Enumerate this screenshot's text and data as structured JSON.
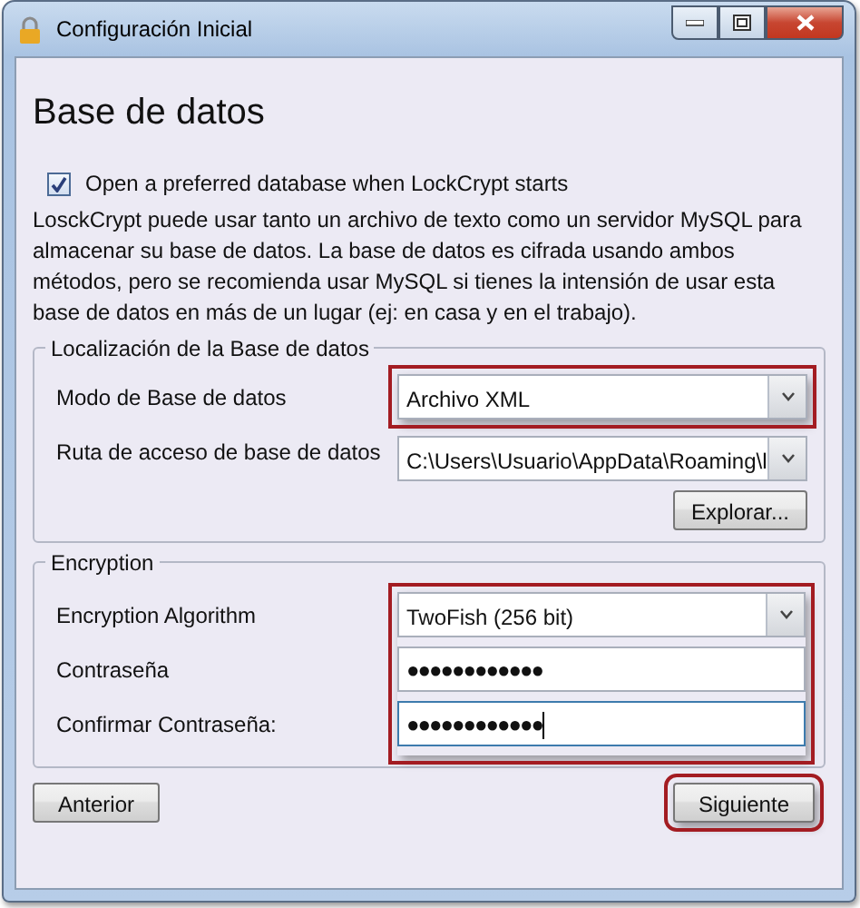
{
  "window": {
    "title": "Configuración Inicial"
  },
  "heading": "Base de datos",
  "open_preferred": {
    "label": "Open a preferred database when LockCrypt starts",
    "checked": true
  },
  "description": "LosckCrypt puede usar tanto un archivo de texto como un servidor MySQL para almacenar su base de datos. La base de datos es cifrada usando ambos métodos, pero se recomienda usar MySQL si tienes la intensión de usar esta base de datos en más de un lugar (ej: en casa y en el trabajo).",
  "sections": [
    {
      "title": "Localización de la Base de datos",
      "highlighted": false,
      "rows": [
        {
          "kind": "combo",
          "label": "Modo de Base de datos",
          "value": "Archivo XML",
          "highlighted": true
        },
        {
          "kind": "combo",
          "label": "Ruta de acceso de base de datos",
          "value": "C:\\Users\\Usuario\\AppData\\Roaming\\l",
          "highlighted": false
        },
        {
          "kind": "button",
          "label": "Explorar..."
        }
      ]
    },
    {
      "title": "Encryption",
      "highlighted": true,
      "rows": [
        {
          "kind": "combo",
          "label": "Encryption Algorithm",
          "value": "TwoFish (256 bit)",
          "highlighted": false
        },
        {
          "kind": "password",
          "label": "Contraseña",
          "value": "●●●●●●●●●●●●",
          "highlighted": false,
          "focused": false
        },
        {
          "kind": "password",
          "label": "Confirmar Contraseña:",
          "value": "●●●●●●●●●●●●",
          "highlighted": false,
          "focused": true
        }
      ]
    }
  ],
  "footer": [
    {
      "label": "Anterior",
      "highlighted": false
    },
    {
      "label": "Siguiente",
      "highlighted": true
    }
  ]
}
